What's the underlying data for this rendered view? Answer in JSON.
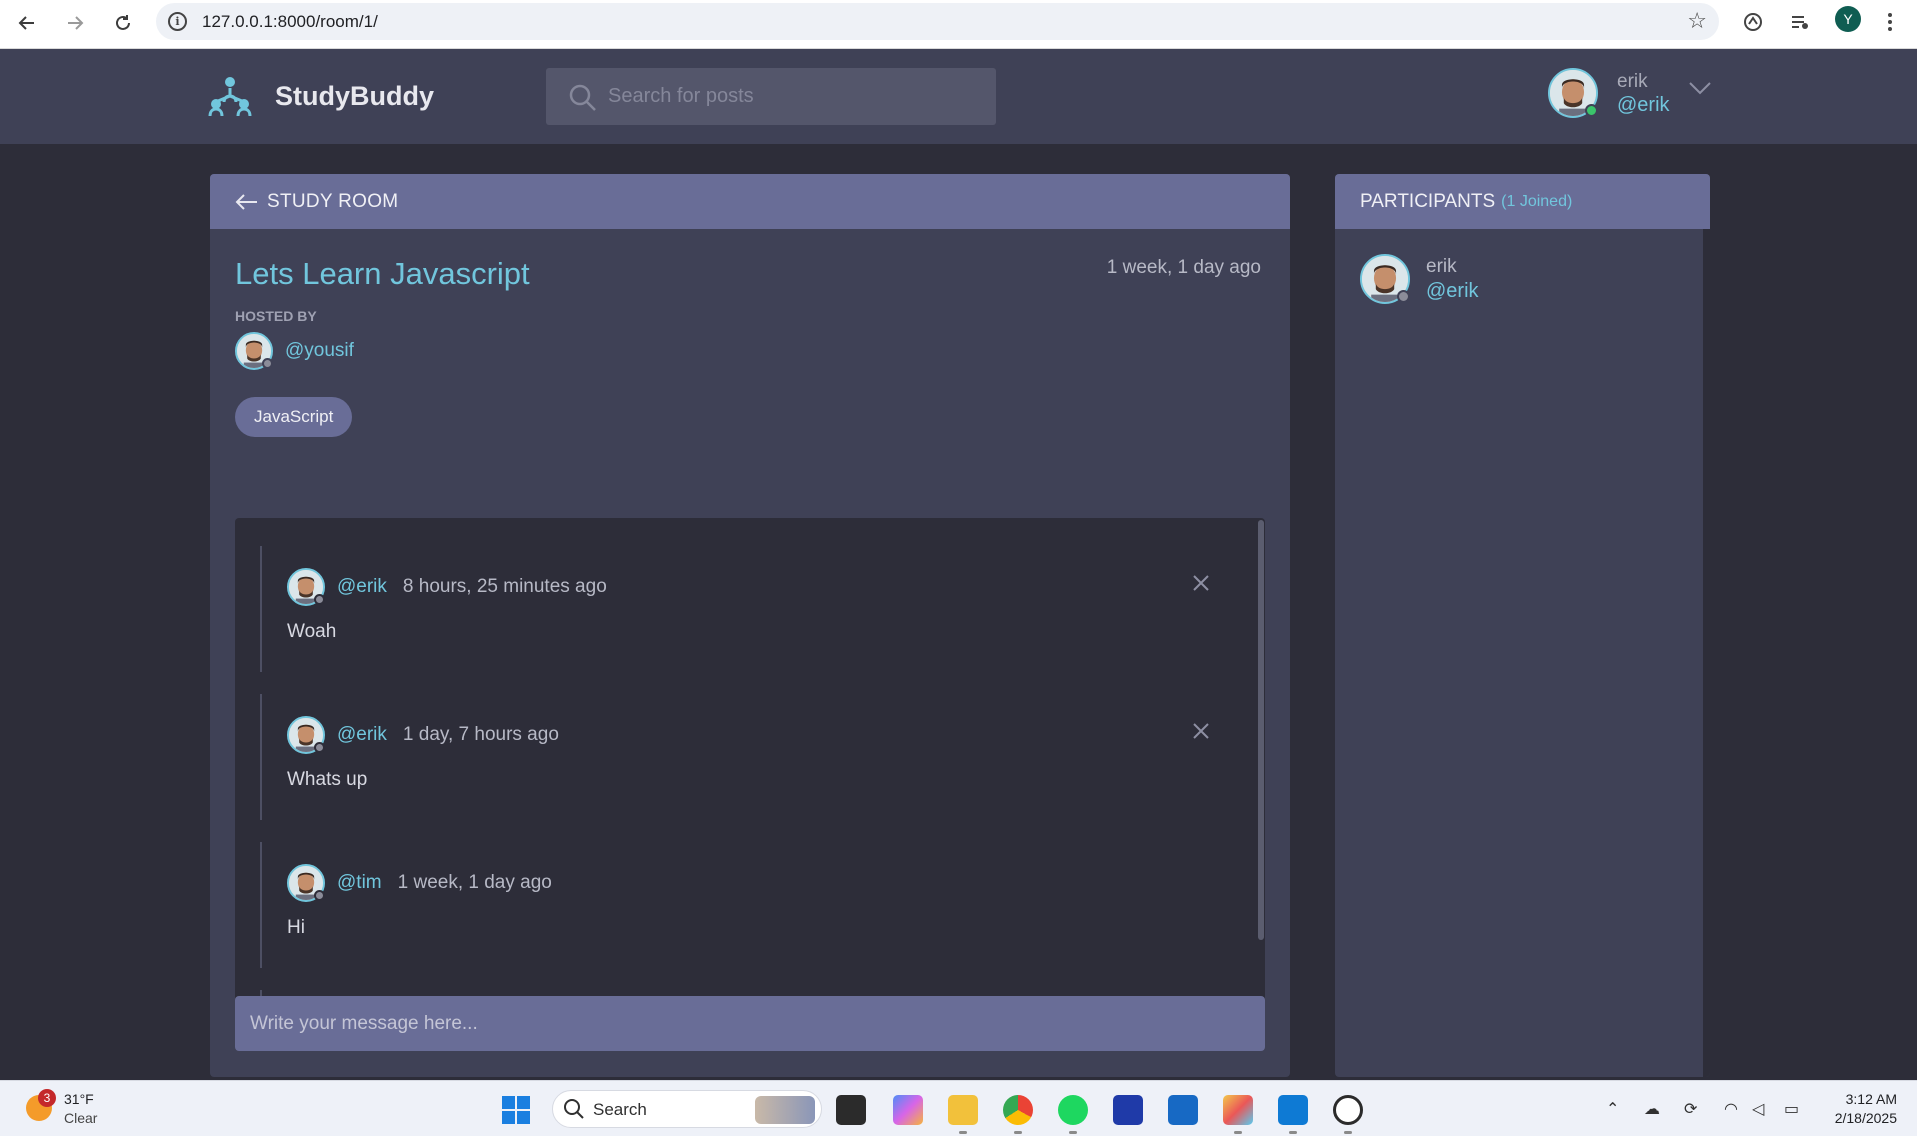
{
  "browser": {
    "url": "127.0.0.1:8000/room/1/",
    "profile_initial": "Y"
  },
  "header": {
    "brand": "StudyBuddy",
    "search_placeholder": "Search for posts",
    "user": {
      "name": "erik",
      "handle": "@erik"
    }
  },
  "room": {
    "section_title": "Study Room",
    "title": "Lets Learn Javascript",
    "created": "1 week, 1 day ago",
    "hosted_by_label": "Hosted By",
    "host_handle": "@yousif",
    "topic": "JavaScript",
    "messages": [
      {
        "handle": "@erik",
        "time": "8 hours, 25 minutes ago",
        "body": "Woah",
        "deletable": true
      },
      {
        "handle": "@erik",
        "time": "1 day, 7 hours ago",
        "body": "Whats up",
        "deletable": true
      },
      {
        "handle": "@tim",
        "time": "1 week, 1 day ago",
        "body": "Hi",
        "deletable": false
      }
    ],
    "composer_placeholder": "Write your message here..."
  },
  "participants": {
    "title": "Participants",
    "count_label": "(1 Joined)",
    "list": [
      {
        "name": "erik",
        "handle": "@erik"
      }
    ]
  },
  "taskbar": {
    "weather_badge": "3",
    "temperature": "31°F",
    "condition": "Clear",
    "search_label": "Search",
    "time": "3:12 AM",
    "date": "2/18/2025"
  },
  "colors": {
    "accent": "#71c6dd",
    "header_bg": "#3f4156",
    "page_bg": "#2d2d39",
    "panel_head": "#696d97",
    "online": "#3bc46b"
  }
}
